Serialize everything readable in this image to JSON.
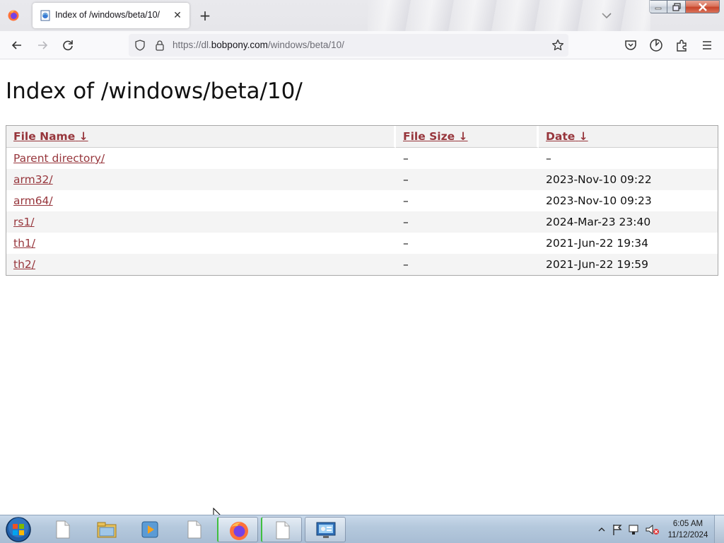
{
  "browser": {
    "tab": {
      "title": "Index of /windows/beta/10/"
    },
    "url": {
      "prefix": "https://dl.",
      "domain": "bobpony.com",
      "path": "/windows/beta/10/"
    }
  },
  "page": {
    "title": "Index of /windows/beta/10/",
    "columns": [
      {
        "label": "File Name",
        "sort_icon": "↓"
      },
      {
        "label": "File Size",
        "sort_icon": "↓"
      },
      {
        "label": "Date",
        "sort_icon": "↓"
      }
    ],
    "rows": [
      {
        "name": "Parent directory/",
        "size": "–",
        "date": "–"
      },
      {
        "name": "arm32/",
        "size": "–",
        "date": "2023-Nov-10 09:22"
      },
      {
        "name": "arm64/",
        "size": "–",
        "date": "2023-Nov-10 09:23"
      },
      {
        "name": "rs1/",
        "size": "–",
        "date": "2024-Mar-23 23:40"
      },
      {
        "name": "th1/",
        "size": "–",
        "date": "2021-Jun-22 19:34"
      },
      {
        "name": "th2/",
        "size": "–",
        "date": "2021-Jun-22 19:59"
      }
    ]
  },
  "taskbar": {
    "clock": {
      "time": "6:05 AM",
      "date": "11/12/2024"
    },
    "items": [
      "file-icon",
      "explorer-icon",
      "media-player-icon",
      "file-icon",
      "firefox-icon",
      "file-icon",
      "control-panel-icon"
    ]
  },
  "colors": {
    "link": "#97363c",
    "taskbar": "#b5c9dd",
    "header_bg": "#f2f2f2"
  }
}
